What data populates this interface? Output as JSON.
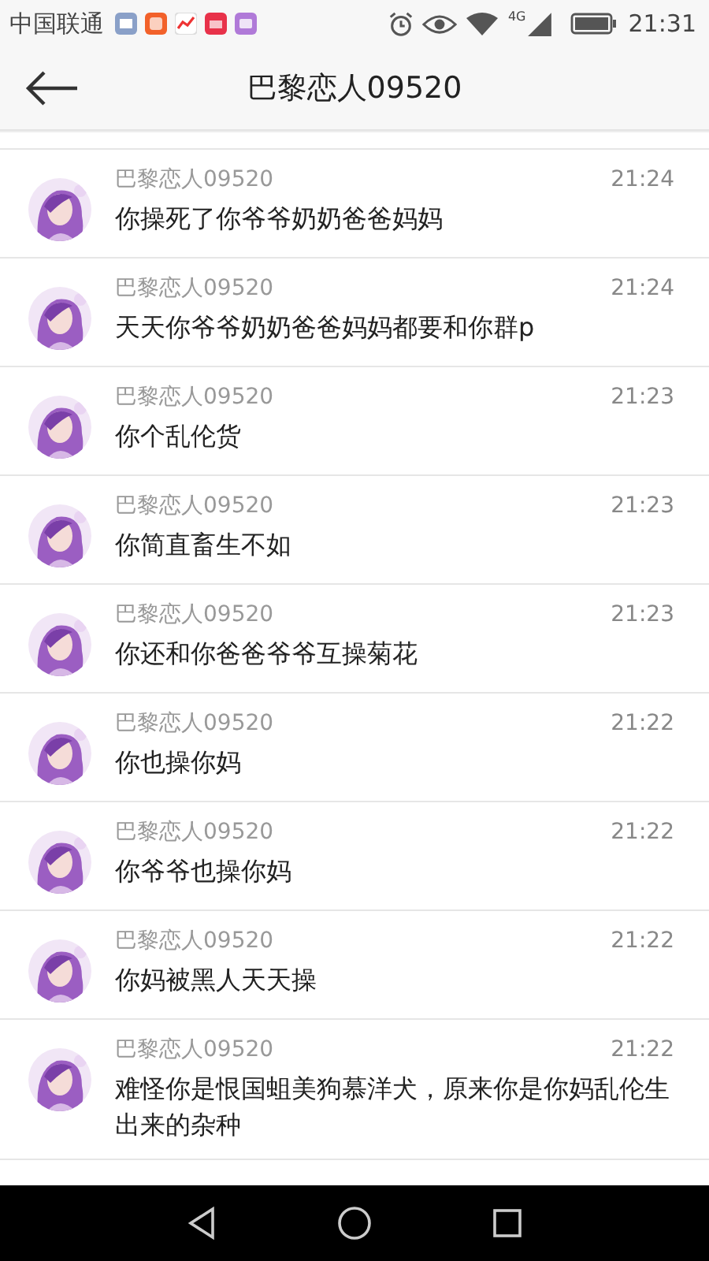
{
  "status_bar": {
    "carrier": "中国联通",
    "network": "4G",
    "time": "21:31"
  },
  "header": {
    "title": "巴黎恋人09520"
  },
  "messages": [
    {
      "sender": "巴黎恋人09520",
      "time": "21:24",
      "text": "你操死了你爷爷奶奶爸爸妈妈"
    },
    {
      "sender": "巴黎恋人09520",
      "time": "21:24",
      "text": "天天你爷爷奶奶爸爸妈妈都要和你群p"
    },
    {
      "sender": "巴黎恋人09520",
      "time": "21:23",
      "text": "你个乱伦货"
    },
    {
      "sender": "巴黎恋人09520",
      "time": "21:23",
      "text": "你简直畜生不如"
    },
    {
      "sender": "巴黎恋人09520",
      "time": "21:23",
      "text": "你还和你爸爸爷爷互操菊花"
    },
    {
      "sender": "巴黎恋人09520",
      "time": "21:22",
      "text": "你也操你妈"
    },
    {
      "sender": "巴黎恋人09520",
      "time": "21:22",
      "text": "你爷爷也操你妈"
    },
    {
      "sender": "巴黎恋人09520",
      "time": "21:22",
      "text": "你妈被黑人天天操"
    },
    {
      "sender": "巴黎恋人09520",
      "time": "21:22",
      "text": "难怪你是恨国蛆美狗慕洋犬，原来你是你妈乱伦生出来的杂种"
    }
  ]
}
